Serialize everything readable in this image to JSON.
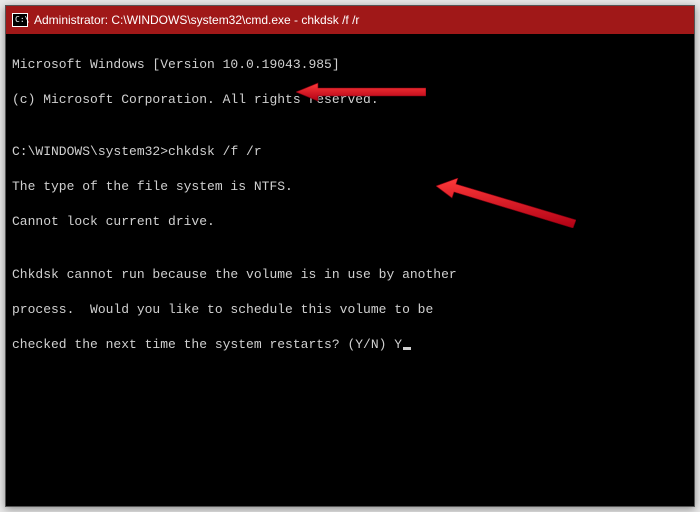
{
  "titlebar": {
    "icon_glyph": "C:\\",
    "title": "Administrator: C:\\WINDOWS\\system32\\cmd.exe - chkdsk  /f /r"
  },
  "terminal": {
    "lines": {
      "l0": "Microsoft Windows [Version 10.0.19043.985]",
      "l1": "(c) Microsoft Corporation. All rights reserved.",
      "l2": "",
      "prompt": "C:\\WINDOWS\\system32>",
      "command": "chkdsk /f /r",
      "l4": "The type of the file system is NTFS.",
      "l5": "Cannot lock current drive.",
      "l6": "",
      "l7": "Chkdsk cannot run because the volume is in use by another",
      "l8": "process.  Would you like to schedule this volume to be",
      "l9_prefix": "checked the next time the system restarts? (Y/N) ",
      "l9_input": "Y"
    }
  },
  "annotations": {
    "arrow_color": "#e3152a"
  }
}
